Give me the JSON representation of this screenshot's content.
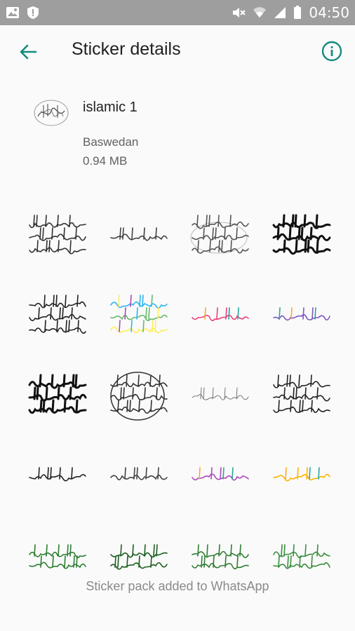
{
  "status_bar": {
    "time": "04:50",
    "icons": [
      "image-icon",
      "shield-icon",
      "mute-icon",
      "wifi-icon",
      "signal-icon",
      "battery-icon"
    ]
  },
  "appbar": {
    "title": "Sticker details",
    "back_icon": "arrow-back-icon",
    "info_icon": "info-icon"
  },
  "pack": {
    "name": "islamic 1",
    "author": "Baswedan",
    "size": "0.94 MB"
  },
  "stickers": [
    {
      "name": "sticker-1",
      "style": "round",
      "color": "#333333"
    },
    {
      "name": "sticker-2",
      "style": "wide",
      "color": "#444444"
    },
    {
      "name": "sticker-3",
      "style": "oval",
      "color": "#555555"
    },
    {
      "name": "sticker-4",
      "style": "bold",
      "color": "#111111"
    },
    {
      "name": "sticker-5",
      "style": "round",
      "color": "#222222"
    },
    {
      "name": "sticker-6",
      "style": "rainbow",
      "color": "#29b6f6"
    },
    {
      "name": "sticker-7",
      "style": "colorwide",
      "color": "#ec407a"
    },
    {
      "name": "sticker-8",
      "style": "colorwide",
      "color": "#7e57c2"
    },
    {
      "name": "sticker-9",
      "style": "bold",
      "color": "#111111"
    },
    {
      "name": "sticker-10",
      "style": "circle",
      "color": "#333333"
    },
    {
      "name": "sticker-11",
      "style": "thin",
      "color": "#666666"
    },
    {
      "name": "sticker-12",
      "style": "round",
      "color": "#222222"
    },
    {
      "name": "sticker-13",
      "style": "wide",
      "color": "#222222"
    },
    {
      "name": "sticker-14",
      "style": "wide",
      "color": "#444444"
    },
    {
      "name": "sticker-15",
      "style": "colorwide",
      "color": "#ab47bc"
    },
    {
      "name": "sticker-16",
      "style": "colorwide",
      "color": "#ffb300"
    },
    {
      "name": "sticker-17",
      "style": "green",
      "color": "#2e7d32"
    },
    {
      "name": "sticker-18",
      "style": "green",
      "color": "#1b5e20"
    },
    {
      "name": "sticker-19",
      "style": "green",
      "color": "#2e7d32"
    },
    {
      "name": "sticker-20",
      "style": "green",
      "color": "#388e3c"
    }
  ],
  "footer": {
    "status": "Sticker pack added to WhatsApp"
  },
  "colors": {
    "accent": "#128c7e",
    "status_bar": "#9e9e9e",
    "background": "#fafafa"
  }
}
